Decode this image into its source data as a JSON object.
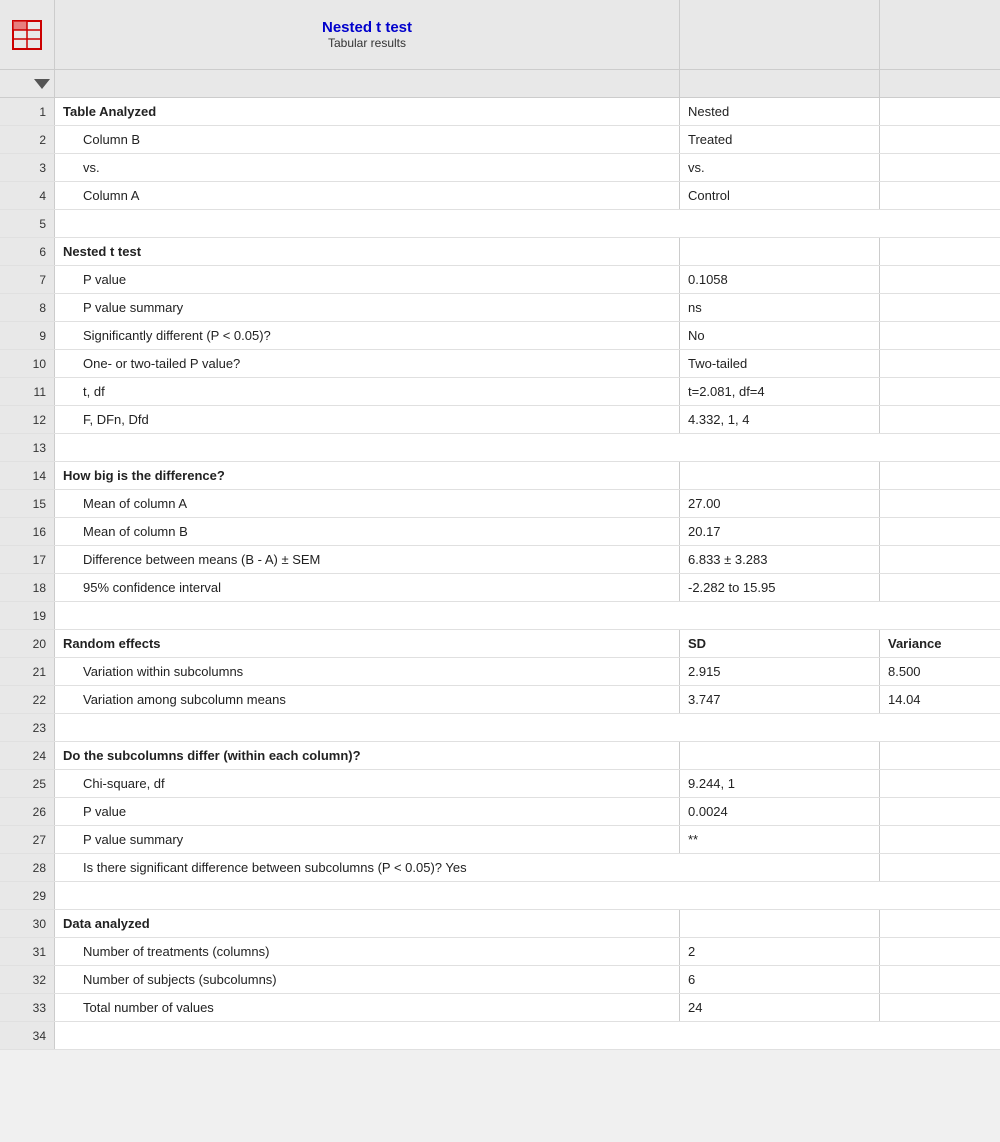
{
  "header": {
    "title": "Nested t test",
    "subtitle": "Tabular results"
  },
  "columns": {
    "b_label": "",
    "c_label": ""
  },
  "rows": [
    {
      "num": 1,
      "a": "Table Analyzed",
      "b": "Nested",
      "c": "",
      "bold_a": true,
      "indented": false
    },
    {
      "num": 2,
      "a": "Column B",
      "b": "Treated",
      "c": "",
      "bold_a": false,
      "indented": true
    },
    {
      "num": 3,
      "a": "vs.",
      "b": "vs.",
      "c": "",
      "bold_a": false,
      "indented": true
    },
    {
      "num": 4,
      "a": "Column A",
      "b": "Control",
      "c": "",
      "bold_a": false,
      "indented": true
    },
    {
      "num": 5,
      "a": "",
      "b": "",
      "c": "",
      "empty": true
    },
    {
      "num": 6,
      "a": "Nested t test",
      "b": "",
      "c": "",
      "bold_a": true,
      "indented": false
    },
    {
      "num": 7,
      "a": "P value",
      "b": "0.1058",
      "c": "",
      "bold_a": false,
      "indented": true
    },
    {
      "num": 8,
      "a": "P value summary",
      "b": "ns",
      "c": "",
      "bold_a": false,
      "indented": true
    },
    {
      "num": 9,
      "a": "Significantly different (P < 0.05)?",
      "b": "No",
      "c": "",
      "bold_a": false,
      "indented": true
    },
    {
      "num": 10,
      "a": "One- or two-tailed P value?",
      "b": "Two-tailed",
      "c": "",
      "bold_a": false,
      "indented": true
    },
    {
      "num": 11,
      "a": "t, df",
      "b": "t=2.081, df=4",
      "c": "",
      "bold_a": false,
      "indented": true
    },
    {
      "num": 12,
      "a": "F, DFn, Dfd",
      "b": "4.332, 1, 4",
      "c": "",
      "bold_a": false,
      "indented": true
    },
    {
      "num": 13,
      "a": "",
      "b": "",
      "c": "",
      "empty": true
    },
    {
      "num": 14,
      "a": "How big is the difference?",
      "b": "",
      "c": "",
      "bold_a": true,
      "indented": false
    },
    {
      "num": 15,
      "a": "Mean of column A",
      "b": "27.00",
      "c": "",
      "bold_a": false,
      "indented": true
    },
    {
      "num": 16,
      "a": "Mean of column B",
      "b": "20.17",
      "c": "",
      "bold_a": false,
      "indented": true
    },
    {
      "num": 17,
      "a": "Difference between means (B - A) ± SEM",
      "b": "6.833 ± 3.283",
      "c": "",
      "bold_a": false,
      "indented": true
    },
    {
      "num": 18,
      "a": "95% confidence interval",
      "b": "-2.282 to 15.95",
      "c": "",
      "bold_a": false,
      "indented": true
    },
    {
      "num": 19,
      "a": "",
      "b": "",
      "c": "",
      "empty": true
    },
    {
      "num": 20,
      "a": "Random effects",
      "b": "SD",
      "c": "Variance",
      "bold_a": true,
      "bold_b": true,
      "bold_c": true,
      "indented": false
    },
    {
      "num": 21,
      "a": "Variation within subcolumns",
      "b": "2.915",
      "c": "8.500",
      "bold_a": false,
      "indented": true
    },
    {
      "num": 22,
      "a": "Variation among subcolumn means",
      "b": "3.747",
      "c": "14.04",
      "bold_a": false,
      "indented": true
    },
    {
      "num": 23,
      "a": "",
      "b": "",
      "c": "",
      "empty": true
    },
    {
      "num": 24,
      "a": "Do the subcolumns differ (within each column)?",
      "b": "",
      "c": "",
      "bold_a": true,
      "indented": false
    },
    {
      "num": 25,
      "a": "Chi-square, df",
      "b": "9.244, 1",
      "c": "",
      "bold_a": false,
      "indented": true
    },
    {
      "num": 26,
      "a": "P value",
      "b": "0.0024",
      "c": "",
      "bold_a": false,
      "indented": true
    },
    {
      "num": 27,
      "a": "P value summary",
      "b": "**",
      "c": "",
      "bold_a": false,
      "indented": true
    },
    {
      "num": 28,
      "a": "Is there significant difference between subcolumns (P < 0.05)? Yes",
      "b": "",
      "c": "",
      "bold_a": false,
      "indented": true,
      "wide": true
    },
    {
      "num": 29,
      "a": "",
      "b": "",
      "c": "",
      "empty": true
    },
    {
      "num": 30,
      "a": "Data analyzed",
      "b": "",
      "c": "",
      "bold_a": true,
      "indented": false
    },
    {
      "num": 31,
      "a": "Number of treatments (columns)",
      "b": "2",
      "c": "",
      "bold_a": false,
      "indented": true
    },
    {
      "num": 32,
      "a": "Number of subjects (subcolumns)",
      "b": "6",
      "c": "",
      "bold_a": false,
      "indented": true
    },
    {
      "num": 33,
      "a": "Total number of values",
      "b": "24",
      "c": "",
      "bold_a": false,
      "indented": true
    },
    {
      "num": 34,
      "a": "",
      "b": "",
      "c": "",
      "empty": true
    }
  ]
}
